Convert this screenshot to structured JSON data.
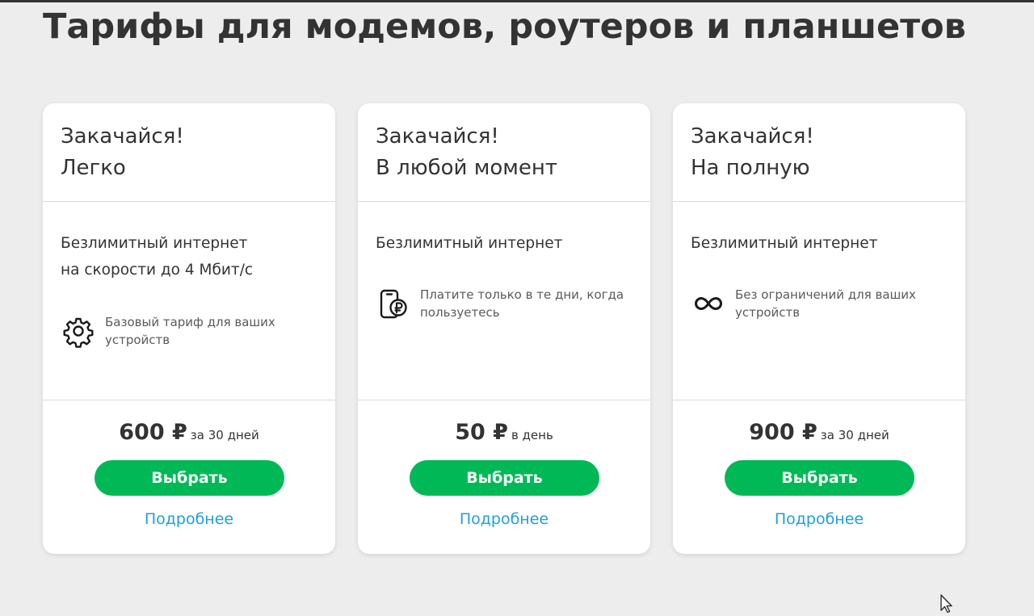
{
  "page": {
    "title": "Тарифы для модемов, роутеров и планшетов"
  },
  "colors": {
    "background": "#ededed",
    "card": "#ffffff",
    "accent_green": "#00b956",
    "link_blue": "#1e9fe0",
    "text_dark": "#333333"
  },
  "cards": [
    {
      "title_line1": "Закачайся!",
      "title_line2": "Легко",
      "feature_line1": "Безлимитный интернет",
      "feature_line2": "на скорости до 4 Мбит/с",
      "perk_icon": "gear-icon",
      "perk_text": "Базовый тариф для ваших устройств",
      "price": "600 ₽",
      "period": "за 30 дней",
      "button_label": "Выбрать",
      "link_label": "Подробнее"
    },
    {
      "title_line1": "Закачайся!",
      "title_line2": "В любой момент",
      "feature_line1": "Безлимитный интернет",
      "perk_icon": "phone-ruble-icon",
      "perk_text": "Платите только в те дни, когда пользуетесь",
      "price": "50 ₽",
      "period": "в день",
      "button_label": "Выбрать",
      "link_label": "Подробнее"
    },
    {
      "title_line1": "Закачайся!",
      "title_line2": "На полную",
      "feature_line1": "Безлимитный интернет",
      "perk_icon": "infinity-icon",
      "perk_text": "Без ограничений для ваших устройств",
      "price": "900 ₽",
      "period": "за 30 дней",
      "button_label": "Выбрать",
      "link_label": "Подробнее"
    }
  ]
}
